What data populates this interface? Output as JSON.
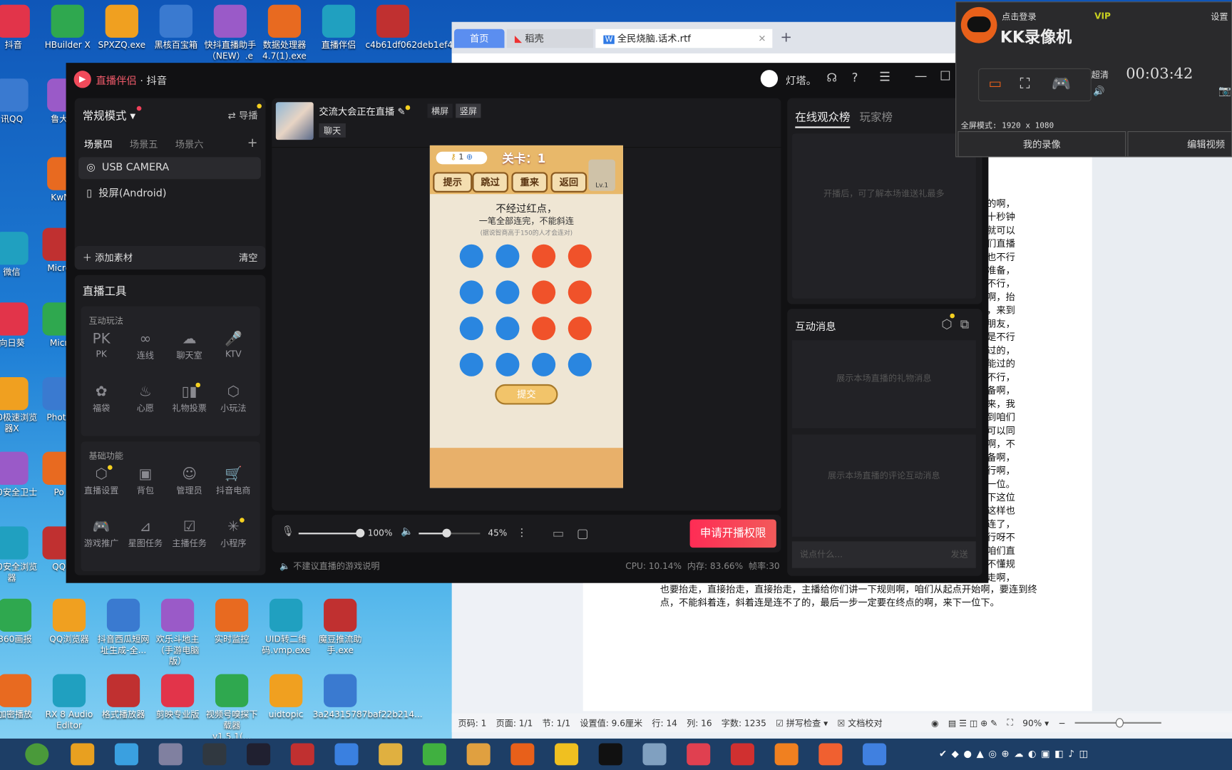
{
  "desktop": {
    "top_icons": [
      "抖音",
      "HBuilder X",
      "SPXZQ.exe",
      "黑核百宝箱",
      "快抖直播助手（NEW）.e",
      "数据处理器4.7(1).exe",
      "直播伴侣",
      "c4b61df062deb1ef497"
    ],
    "left_icons": [
      "讯QQ",
      "鲁大师",
      "KwMu",
      "微信",
      "Micro",
      "向日葵",
      "Micr",
      "360极速浏览器X",
      "Photo",
      "360安全卫士",
      "Po",
      "360安全浏览器",
      "QQ"
    ],
    "row1_icons": [
      "360画报",
      "QQ浏览器",
      "抖音西瓜短网址生成-全...",
      "欢乐斗地主（手游电脑版）",
      "实时监控",
      "UID转二维码.vmp.exe",
      "魔豆推流助手.exe"
    ],
    "row2_icons": [
      "加密播放",
      "RX 8 Audio Editor",
      "格式播放器",
      "剪映专业版",
      "视频号嗅探下载器v1.5.1(...",
      "uidtopic",
      "3a24315787baf22b214..."
    ]
  },
  "wps": {
    "tabs": [
      "首页",
      "稻壳",
      "全民烧脑.话术.rtf"
    ],
    "doc_fragments": [
      "上的啊，",
      "十秒钟",
      "就可以",
      "们直播",
      "也不行",
      "好准备，",
      "行不行，",
      "啊，抬",
      "，来到",
      "朋友，",
      "是不行",
      "以过的，",
      "能过的",
      "是不行，",
      "准备啊，",
      "来，我",
      "到咱们",
      "可以同",
      "啊，不",
      "准备啊，",
      "不行啊，",
      "下一位。",
      "下这位",
      "这样也",
      "始连了，",
      "行呀不",
      "咱们直",
      "不懂规",
      "抬走啊，"
    ],
    "doc_full_lines": [
      "也要抬走，直接抬走，直接抬走，主播给你们讲一下规则啊，咱们从起点开始啊，要连到终",
      "点，不能斜着连，斜着连是连不了的，最后一步一定要在终点的啊，来下一位下。"
    ],
    "status": [
      "页码: 1",
      "页面: 1/1",
      "节: 1/1",
      "设置值: 9.6厘米",
      "行: 14",
      "列: 16",
      "字数: 1235",
      "拼写检查",
      "文档校对",
      "90%"
    ],
    "zoom_percent": 90
  },
  "app": {
    "title_brand": "直播伴侣",
    "title_suffix": "· 抖音",
    "username": "灯塔。",
    "mode": "常规模式",
    "guide": "导播",
    "scenes": [
      "场景四",
      "场景五",
      "场景六"
    ],
    "active_scene": 0,
    "sources": [
      "USB CAMERA",
      "投屏(Android)"
    ],
    "add_source": "添加素材",
    "clear": "清空",
    "tools_title": "直播工具",
    "group1": {
      "title": "互动玩法",
      "items": [
        {
          "label": "PK",
          "icon": "pk-icon",
          "glyph": "PK"
        },
        {
          "label": "连线",
          "icon": "link-icon",
          "glyph": "∞"
        },
        {
          "label": "聊天室",
          "icon": "chat-room-icon",
          "glyph": "☁"
        },
        {
          "label": "KTV",
          "icon": "microphone-icon",
          "glyph": "🎤"
        },
        {
          "label": "福袋",
          "icon": "lucky-bag-icon",
          "glyph": "✿"
        },
        {
          "label": "心愿",
          "icon": "wish-lamp-icon",
          "glyph": "♨"
        },
        {
          "label": "礼物投票",
          "icon": "vote-chart-icon",
          "glyph": "▯▮"
        },
        {
          "label": "小玩法",
          "icon": "cube-icon",
          "glyph": "⬡"
        }
      ]
    },
    "group2": {
      "title": "基础功能",
      "items": [
        {
          "label": "直播设置",
          "icon": "settings-hex-icon",
          "glyph": "⬡"
        },
        {
          "label": "背包",
          "icon": "backpack-icon",
          "glyph": "▣"
        },
        {
          "label": "管理员",
          "icon": "admin-user-icon",
          "glyph": "☺"
        },
        {
          "label": "抖音电商",
          "icon": "cart-icon",
          "glyph": "🛒"
        },
        {
          "label": "游戏推广",
          "icon": "gamepad-icon",
          "glyph": "🎮"
        },
        {
          "label": "星图任务",
          "icon": "star-map-icon",
          "glyph": "⊿"
        },
        {
          "label": "主播任务",
          "icon": "task-calendar-icon",
          "glyph": "☑"
        },
        {
          "label": "小程序",
          "icon": "mini-program-icon",
          "glyph": "✳"
        }
      ]
    },
    "stream_title": "交流大会正在直播",
    "orientation": [
      "横屏",
      "竖屏"
    ],
    "category": "聊天",
    "game": {
      "keys": "1",
      "level": "关卡：1",
      "buttons": [
        "提示",
        "跳过",
        "重来",
        "返回"
      ],
      "lv": "Lv.1",
      "line1": "不经过红点，",
      "line2": "一笔全部连完，不能斜连",
      "line3": "(据说智商高于150的人才会连对)",
      "submit": "提交",
      "grid": [
        [
          "blue",
          "blue",
          "red",
          "red"
        ],
        [
          "blue",
          "blue",
          "red",
          "red"
        ],
        [
          "blue",
          "blue",
          "red",
          "red"
        ],
        [
          "blue",
          "blue",
          "blue",
          "blue"
        ]
      ],
      "colors": {
        "blue": "#2a86e0",
        "red": "#f0522a"
      }
    },
    "mic_volume": "100%",
    "mic_level": 100,
    "speaker_volume": "45%",
    "speaker_level": 45,
    "start_button": "申请开播权限",
    "notice": "不建议直播的游戏说明",
    "cpu": "CPU: 10.14%",
    "memory": "内存: 83.66%",
    "fps": "帧率:30",
    "right": {
      "tabs": [
        "在线观众榜",
        "玩家榜"
      ],
      "audience_empty": "开播后，可了解本场谁送礼最多",
      "messages_title": "互动消息",
      "gift_empty": "展示本场直播的礼物消息",
      "comment_empty": "展示本场直播的评论互动消息",
      "input_placeholder": "说点什么...",
      "send": "发送"
    },
    "accent": "#fe2c55"
  },
  "kk": {
    "login": "点击登录",
    "vip": "VIP",
    "title": "KK录像机",
    "settings": "设置",
    "quality": "超清",
    "timer": "00:03:42",
    "mode": "全屏模式: 1920 x 1080",
    "my_recordings": "我的录像",
    "edit_video": "编辑视频"
  }
}
